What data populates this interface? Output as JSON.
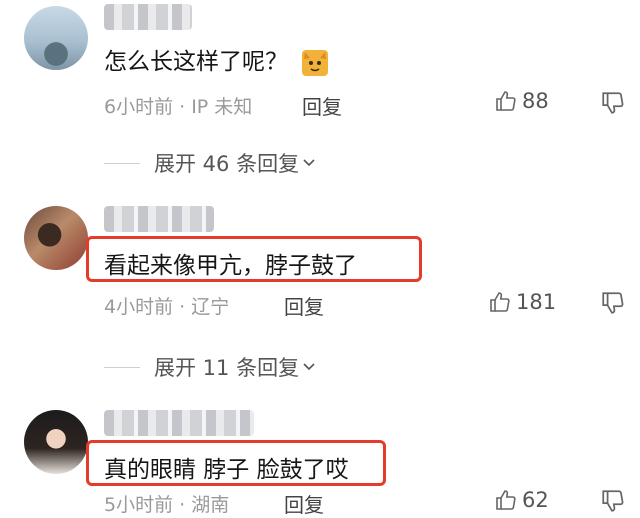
{
  "comments": [
    {
      "text": "怎么长这样了呢？",
      "meta": "6小时前 · IP 未知",
      "reply_label": "回复",
      "likes": "88",
      "emoji": "cat-sticker"
    },
    {
      "text": "看起来像甲亢，脖子鼓了",
      "meta": "4小时前 · 辽宁",
      "reply_label": "回复",
      "likes": "181"
    },
    {
      "text": "真的眼睛 脖子 脸鼓了哎",
      "meta": "5小时前 · 湖南",
      "reply_label": "回复",
      "likes": "62"
    }
  ],
  "expand_replies": [
    {
      "label": "展开 46 条回复"
    },
    {
      "label": "展开 11 条回复"
    }
  ],
  "colors": {
    "highlight_border": "#e53b2a",
    "meta_text": "#9a9a9a",
    "body_text": "#161616"
  }
}
